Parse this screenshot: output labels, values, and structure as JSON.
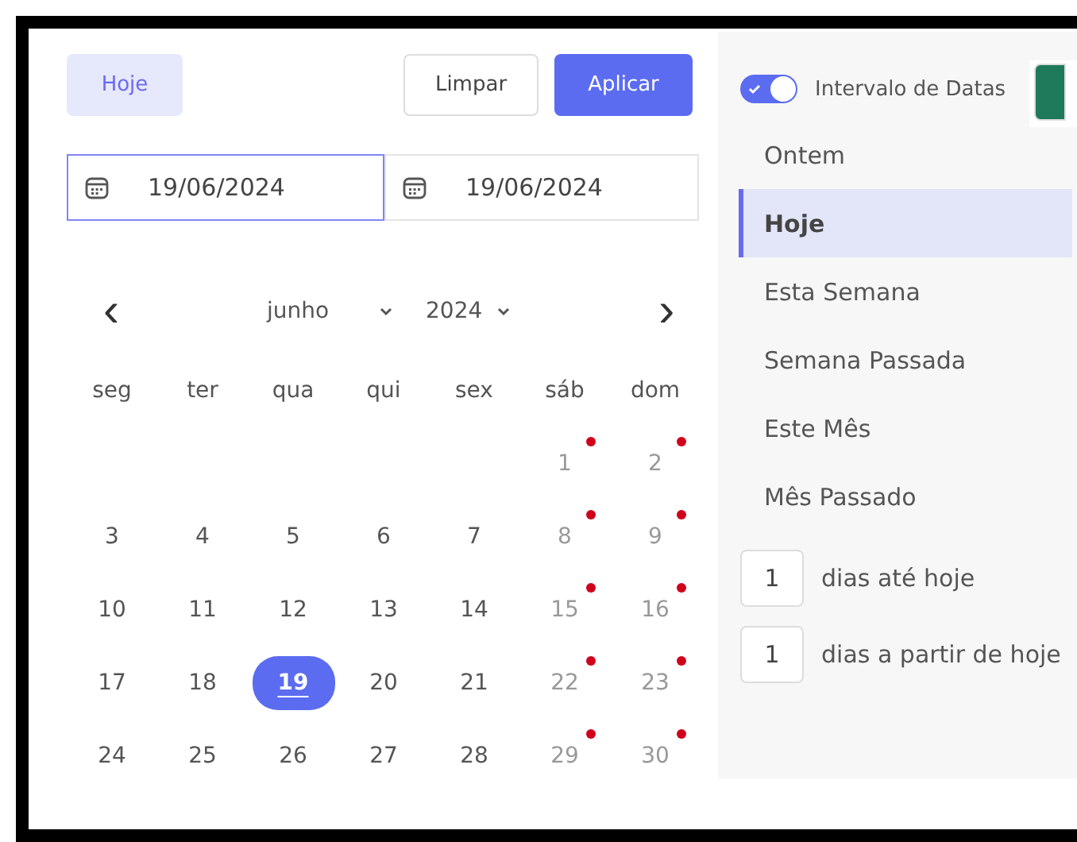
{
  "actions": {
    "today_button": "Hoje",
    "clear_button": "Limpar",
    "apply_button": "Aplicar"
  },
  "date_fields": [
    {
      "value": "19/06/2024",
      "focused": true
    },
    {
      "value": "19/06/2024",
      "focused": false
    }
  ],
  "calendar": {
    "prev": "‹",
    "next": "›",
    "month": "junho",
    "year": "2024",
    "weekdays": [
      {
        "label": "seg"
      },
      {
        "label": "ter"
      },
      {
        "label": "qua"
      },
      {
        "label": "qui"
      },
      {
        "label": "sex"
      },
      {
        "label": "sáb"
      },
      {
        "label": "dom"
      }
    ],
    "days": [
      {
        "label": "1",
        "selected": false,
        "weekend": true,
        "marked": true
      },
      {
        "label": "2",
        "selected": false,
        "weekend": true,
        "marked": true
      },
      {
        "label": "3",
        "selected": false,
        "weekend": false,
        "marked": false
      },
      {
        "label": "4",
        "selected": false,
        "weekend": false,
        "marked": false
      },
      {
        "label": "5",
        "selected": false,
        "weekend": false,
        "marked": false
      },
      {
        "label": "6",
        "selected": false,
        "weekend": false,
        "marked": false
      },
      {
        "label": "7",
        "selected": false,
        "weekend": false,
        "marked": false
      },
      {
        "label": "8",
        "selected": false,
        "weekend": true,
        "marked": true
      },
      {
        "label": "9",
        "selected": false,
        "weekend": true,
        "marked": true
      },
      {
        "label": "10",
        "selected": false,
        "weekend": false,
        "marked": false
      },
      {
        "label": "11",
        "selected": false,
        "weekend": false,
        "marked": false
      },
      {
        "label": "12",
        "selected": false,
        "weekend": false,
        "marked": false
      },
      {
        "label": "13",
        "selected": false,
        "weekend": false,
        "marked": false
      },
      {
        "label": "14",
        "selected": false,
        "weekend": false,
        "marked": false
      },
      {
        "label": "15",
        "selected": false,
        "weekend": true,
        "marked": true
      },
      {
        "label": "16",
        "selected": false,
        "weekend": true,
        "marked": true
      },
      {
        "label": "17",
        "selected": false,
        "weekend": false,
        "marked": false
      },
      {
        "label": "18",
        "selected": false,
        "weekend": false,
        "marked": false
      },
      {
        "label": "19",
        "selected": true,
        "weekend": false,
        "marked": false
      },
      {
        "label": "20",
        "selected": false,
        "weekend": false,
        "marked": false
      },
      {
        "label": "21",
        "selected": false,
        "weekend": false,
        "marked": false
      },
      {
        "label": "22",
        "selected": false,
        "weekend": true,
        "marked": true
      },
      {
        "label": "23",
        "selected": false,
        "weekend": true,
        "marked": true
      },
      {
        "label": "24",
        "selected": false,
        "weekend": false,
        "marked": false
      },
      {
        "label": "25",
        "selected": false,
        "weekend": false,
        "marked": false
      },
      {
        "label": "26",
        "selected": false,
        "weekend": false,
        "marked": false
      },
      {
        "label": "27",
        "selected": false,
        "weekend": false,
        "marked": false
      },
      {
        "label": "28",
        "selected": false,
        "weekend": false,
        "marked": false
      },
      {
        "label": "29",
        "selected": false,
        "weekend": true,
        "marked": true
      },
      {
        "label": "30",
        "selected": false,
        "weekend": true,
        "marked": true
      }
    ]
  },
  "sidebar": {
    "toggle": {
      "label": "Intervalo de Datas",
      "on": true
    },
    "presets": [
      {
        "label": "Ontem",
        "selected": false
      },
      {
        "label": "Hoje",
        "selected": true
      },
      {
        "label": "Esta Semana",
        "selected": false
      },
      {
        "label": "Semana Passada",
        "selected": false
      },
      {
        "label": "Este Mês",
        "selected": false
      },
      {
        "label": "Mês Passado",
        "selected": false
      }
    ],
    "day_inputs": [
      {
        "value": "1",
        "label": "dias até hoje"
      },
      {
        "value": "1",
        "label": "dias a partir de hoje"
      }
    ]
  }
}
